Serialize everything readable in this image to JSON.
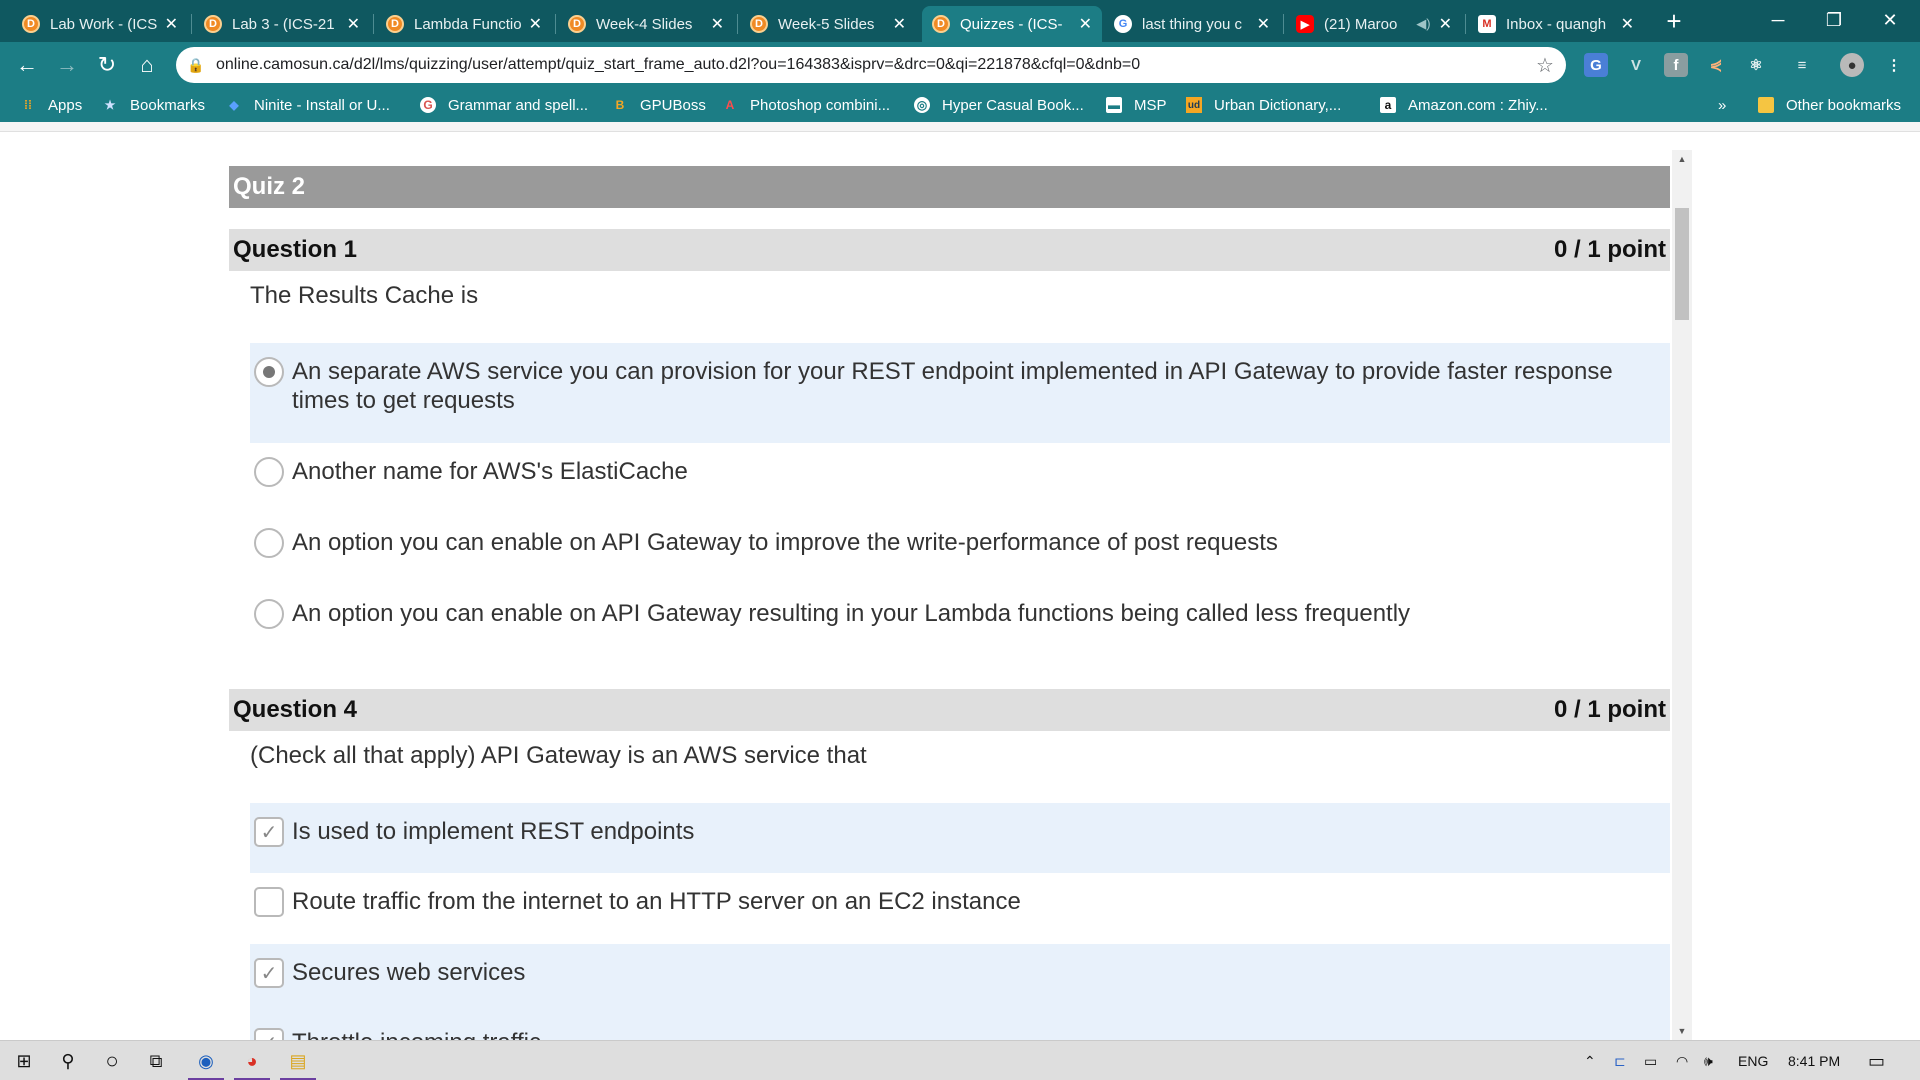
{
  "browser": {
    "tabs": [
      {
        "label": "Lab Work - (ICS-",
        "favicon": "d2l-icon",
        "active": false
      },
      {
        "label": "Lab 3 - (ICS-21",
        "favicon": "d2l-icon",
        "active": false
      },
      {
        "label": "Lambda Functio",
        "favicon": "d2l-icon",
        "active": false
      },
      {
        "label": "Week-4 Slides",
        "favicon": "d2l-icon",
        "active": false
      },
      {
        "label": "Week-5 Slides",
        "favicon": "d2l-icon",
        "active": false
      },
      {
        "label": "Quizzes - (ICS-",
        "favicon": "d2l-icon",
        "active": true
      },
      {
        "label": "last thing you c",
        "favicon": "google-icon",
        "active": false
      },
      {
        "label": "(21) Maroo",
        "favicon": "youtube-icon",
        "active": false
      },
      {
        "label": "Inbox - quangh",
        "favicon": "gmail-icon",
        "active": false
      }
    ],
    "url": "online.camosun.ca/d2l/lms/quizzing/user/attempt/quiz_start_frame_auto.d2l?ou=164383&isprv=&drc=0&qi=221878&cfql=0&dnb=0",
    "bookmarks": [
      {
        "label": "Apps",
        "icon": "apps-grid-icon"
      },
      {
        "label": "Bookmarks",
        "icon": "star-icon"
      },
      {
        "label": "Ninite - Install or U...",
        "icon": "ninite-icon"
      },
      {
        "label": "Grammar and spell...",
        "icon": "grammarly-icon"
      },
      {
        "label": "GPUBoss",
        "icon": "gpuboss-icon"
      },
      {
        "label": "Photoshop combini...",
        "icon": "adobe-icon"
      },
      {
        "label": "Hyper Casual Book...",
        "icon": "globe-icon"
      },
      {
        "label": "MSP",
        "icon": "msp-icon"
      },
      {
        "label": "Urban Dictionary,...",
        "icon": "ud-icon"
      },
      {
        "label": "Amazon.com : Zhiy...",
        "icon": "amazon-icon"
      }
    ],
    "overflow": "»",
    "other_bookmarks": "Other bookmarks"
  },
  "quiz": {
    "title": "Quiz 2",
    "questions": [
      {
        "label": "Question 1",
        "score": "0 / 1 point",
        "text": "The Results Cache is",
        "type": "radio",
        "options": [
          {
            "text": "An separate AWS service you can provision for your REST endpoint implemented in API Gateway to provide faster response times to get requests",
            "selected": true
          },
          {
            "text": "Another name for AWS's ElastiCache",
            "selected": false
          },
          {
            "text": "An option you can enable on API Gateway to improve the write-performance of post requests",
            "selected": false
          },
          {
            "text": "An option you can enable on API Gateway resulting in your Lambda functions being called less frequently",
            "selected": false
          }
        ]
      },
      {
        "label": "Question 4",
        "score": "0 / 1 point",
        "text": "(Check all that apply) API Gateway is an AWS service that",
        "type": "checkbox",
        "options": [
          {
            "text": "Is used to implement REST endpoints",
            "selected": true
          },
          {
            "text": "Route traffic from the internet to an HTTP server on an EC2 instance",
            "selected": false
          },
          {
            "text": "Secures web services",
            "selected": true
          },
          {
            "text": "Throttle incoming traffic",
            "selected": true
          }
        ]
      }
    ]
  },
  "taskbar": {
    "language": "ENG",
    "time": "8:41 PM"
  },
  "colors": {
    "tabstrip": "#0f5860",
    "toolbar": "#1c7d85",
    "quiz_title_bg": "#9a9a9a",
    "question_header_bg": "#dedede",
    "selected_option_bg": "#e8f1fb"
  }
}
